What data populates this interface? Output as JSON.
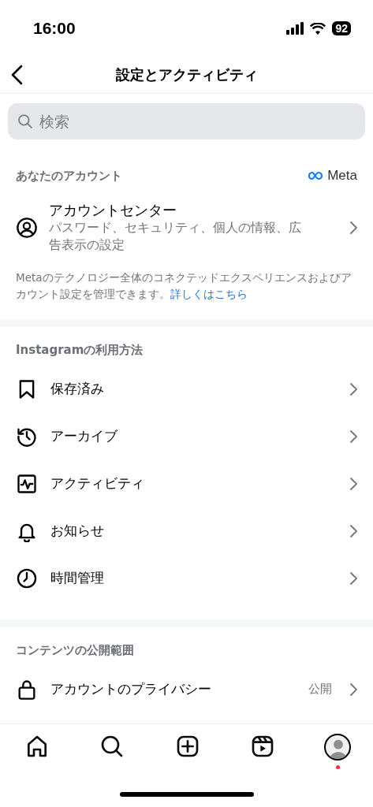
{
  "status_bar": {
    "time": "16:00",
    "battery": "92"
  },
  "header": {
    "title": "設定とアクティビティ"
  },
  "search": {
    "placeholder": "検索"
  },
  "account_section": {
    "title": "あなたのアカウント",
    "brand": "Meta",
    "item": {
      "label": "アカウントセンター",
      "subtitle": "パスワード、セキュリティ、個人の情報、広告表示の設定"
    },
    "description": "Metaのテクノロジー全体のコネクテッドエクスペリエンスおよびアカウント設定を管理できます。",
    "link": "詳しくはこちら"
  },
  "sections": [
    {
      "title": "Instagramの利用方法",
      "items": [
        {
          "label": "保存済み"
        },
        {
          "label": "アーカイブ"
        },
        {
          "label": "アクティビティ"
        },
        {
          "label": "お知らせ"
        },
        {
          "label": "時間管理"
        }
      ]
    },
    {
      "title": "コンテンツの公開範囲",
      "items": [
        {
          "label": "アカウントのプライバシー",
          "value": "公開"
        }
      ]
    }
  ],
  "nav": [
    {
      "selected": false
    },
    {
      "selected": false
    },
    {
      "selected": false
    },
    {
      "selected": false
    },
    {
      "selected": true,
      "badge_dot": true
    }
  ]
}
